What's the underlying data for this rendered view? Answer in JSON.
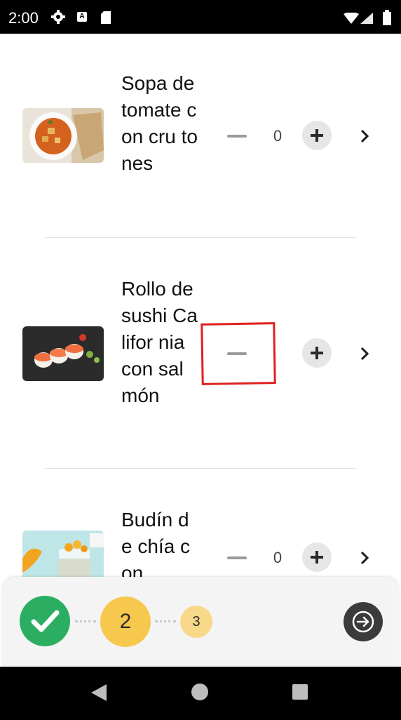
{
  "status_bar": {
    "time": "2:00",
    "icons": [
      "gear-icon",
      "a-icon",
      "sd-card-icon",
      "wifi-icon",
      "signal-icon",
      "battery-icon"
    ]
  },
  "items": [
    {
      "name": "Sopa de tomate con cru tones",
      "quantity": "0",
      "thumb": "tomato-soup-image"
    },
    {
      "name": "Rollo de sushi Califor nia con salmón",
      "quantity": "",
      "thumb": "sushi-roll-image"
    },
    {
      "name": "Budín de chía con",
      "quantity": "0",
      "thumb": "chia-pudding-image"
    }
  ],
  "stepper": {
    "steps": [
      "done",
      "2",
      "3"
    ],
    "current_step": 2,
    "next_icon": "arrow-right-icon"
  },
  "colors": {
    "done": "#2bae61",
    "current": "#f6c84e",
    "upcoming": "#f8d98a",
    "highlight": "#e01f1f",
    "next_button": "#3b3b3b"
  },
  "nav_bar": {
    "icons": [
      "back-icon",
      "home-icon",
      "recents-icon"
    ]
  }
}
